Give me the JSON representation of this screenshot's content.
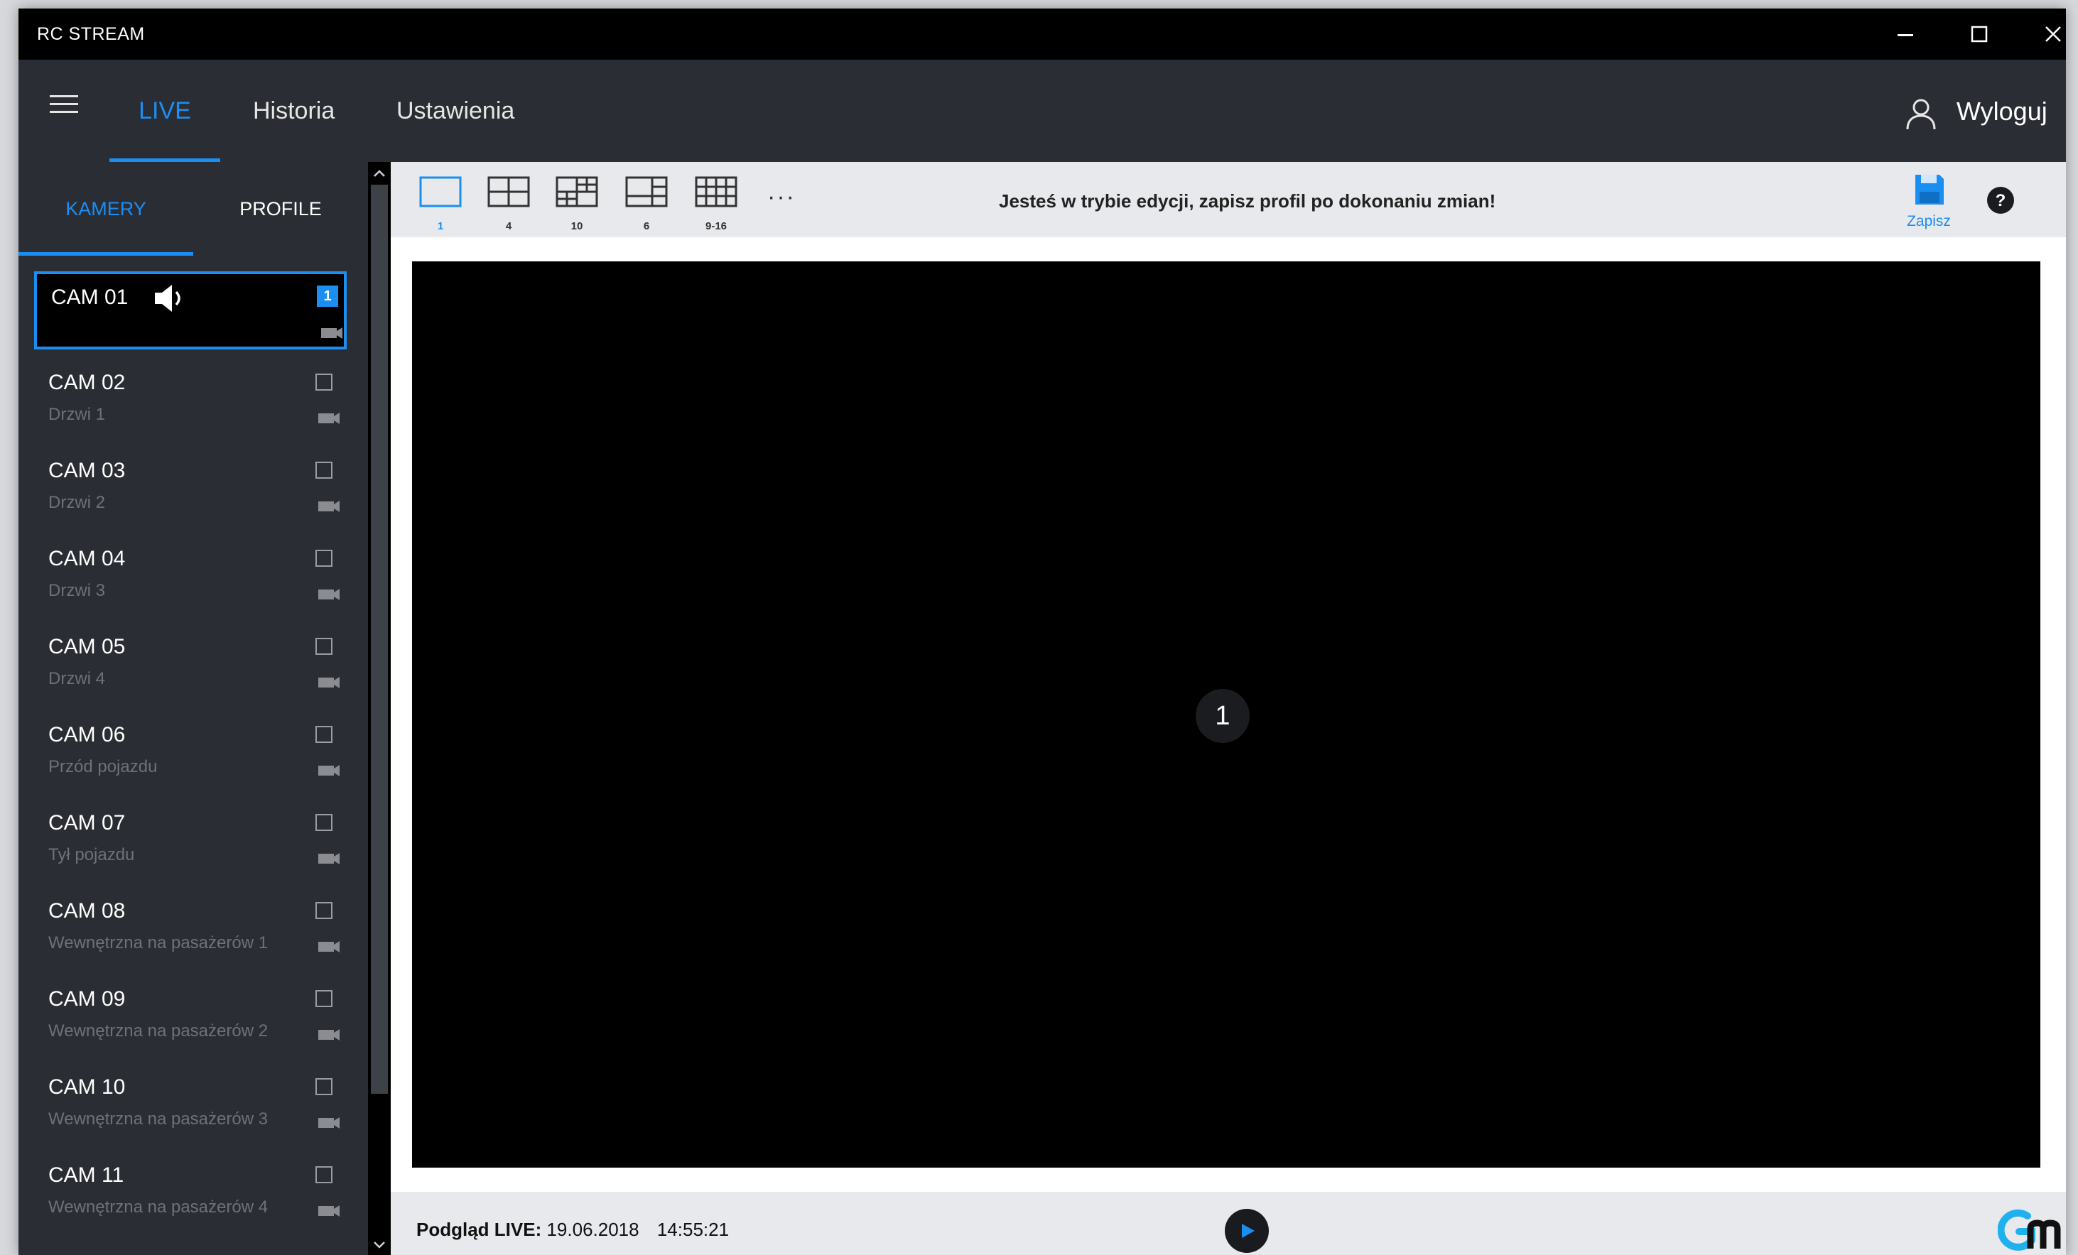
{
  "window": {
    "title": "RC STREAM",
    "controls": [
      "minimize-icon",
      "maximize-icon",
      "close-icon"
    ]
  },
  "nav": {
    "tabs": [
      {
        "label": "LIVE",
        "active": true
      },
      {
        "label": "Historia",
        "active": false
      },
      {
        "label": "Ustawienia",
        "active": false
      }
    ],
    "logout_label": "Wyloguj"
  },
  "sidebar": {
    "tabs": [
      {
        "label": "KAMERY",
        "active": true
      },
      {
        "label": "PROFILE",
        "active": false
      }
    ],
    "cameras": [
      {
        "name": "CAM 01",
        "desc": "",
        "selected": true,
        "badge": "1",
        "audio": true
      },
      {
        "name": "CAM 02",
        "desc": "Drzwi 1"
      },
      {
        "name": "CAM 03",
        "desc": "Drzwi 2"
      },
      {
        "name": "CAM 04",
        "desc": "Drzwi 3"
      },
      {
        "name": "CAM 05",
        "desc": "Drzwi 4"
      },
      {
        "name": "CAM 06",
        "desc": "Przód pojazdu"
      },
      {
        "name": "CAM 07",
        "desc": "Tył pojazdu"
      },
      {
        "name": "CAM 08",
        "desc": "Wewnętrzna na pasażerów 1"
      },
      {
        "name": "CAM 09",
        "desc": "Wewnętrzna na pasażerów 2"
      },
      {
        "name": "CAM 10",
        "desc": "Wewnętrzna na pasażerów 3"
      },
      {
        "name": "CAM 11",
        "desc": "Wewnętrzna na pasażerów 4"
      }
    ]
  },
  "toolbar": {
    "layouts": [
      {
        "label": "1",
        "active": true
      },
      {
        "label": "4"
      },
      {
        "label": "10"
      },
      {
        "label": "6"
      },
      {
        "label": "9-16"
      }
    ],
    "more_label": "···",
    "edit_message": "Jesteś w trybie edycji, zapisz profil po dokonaniu zmian!",
    "save_label": "Zapisz"
  },
  "viewer": {
    "tile_number": "1"
  },
  "status": {
    "label": "Podgląd LIVE:",
    "date": "19.06.2018",
    "time": "14:55:21"
  },
  "colors": {
    "accent": "#1b8ef2",
    "background": "#2a2c33",
    "titlebar": "#000000"
  }
}
